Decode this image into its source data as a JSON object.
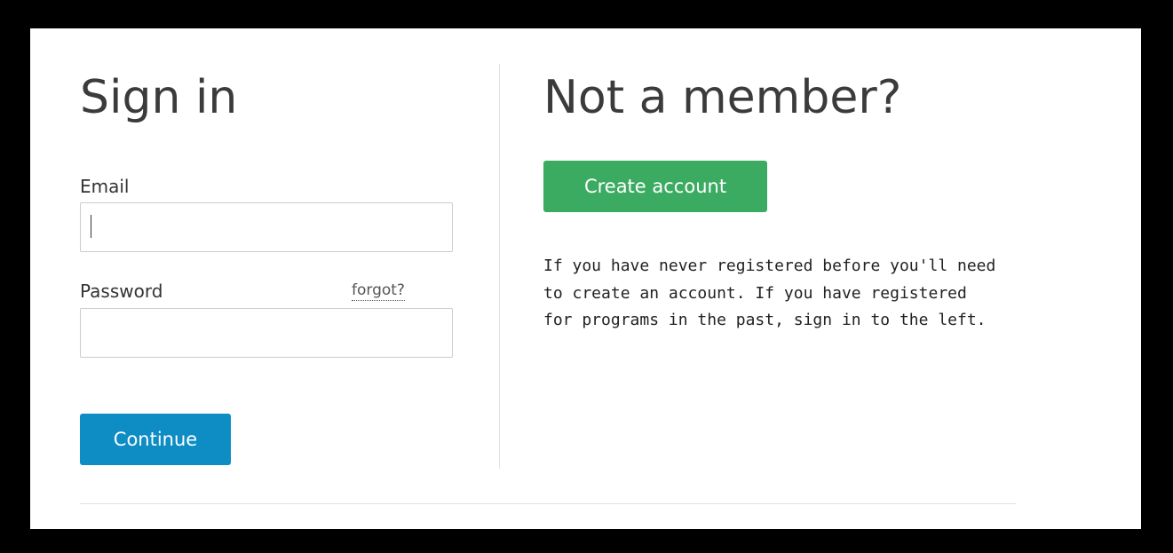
{
  "signin": {
    "title": "Sign in",
    "email_label": "Email",
    "email_value": "",
    "password_label": "Password",
    "password_value": "",
    "forgot_label": "forgot?",
    "continue_label": "Continue"
  },
  "register": {
    "title": "Not a member?",
    "create_label": "Create account",
    "info": "If you have never registered before you'll need to create an account. If you have registered for programs in the past, sign in to the left."
  },
  "colors": {
    "continue_button": "#0e8cc4",
    "create_button": "#3cab62",
    "divider": "#e2e2e2"
  }
}
